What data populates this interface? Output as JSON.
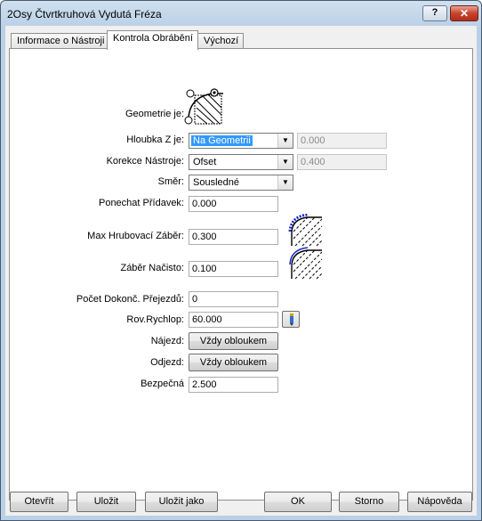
{
  "window": {
    "title": "2Osy Čtvrtkruhová Vydutá Fréza"
  },
  "titlebar": {
    "help_label": "?",
    "close_label": "✕"
  },
  "tabs": [
    {
      "label": "Informace o Nástroji"
    },
    {
      "label": "Kontrola Obrábění"
    },
    {
      "label": "Výchozí"
    }
  ],
  "form": {
    "geometry_label": "Geometrie je:",
    "depth": {
      "label": "Hloubka Z je:",
      "value": "Na Geometrii",
      "disabled_value": "0.000"
    },
    "compensation": {
      "label": "Korekce Nástroje:",
      "value": "Ofset",
      "disabled_value": "0.400"
    },
    "direction": {
      "label": "Směr:",
      "value": "Sousledné"
    },
    "stock": {
      "label": "Ponechat Přídavek:",
      "value": "0.000"
    },
    "max_rough": {
      "label": "Max Hrubovací Záběr:",
      "value": "0.300"
    },
    "finish_cut": {
      "label": "Záběr Načisto:",
      "value": "0.100"
    },
    "finish_passes": {
      "label": "Počet Dokonč. Přejezdů:",
      "value": "0"
    },
    "feed": {
      "label": "Rov.Rychlop:",
      "value": "60.000"
    },
    "approach": {
      "label": "Nájezd:",
      "button": "Vždy obloukem"
    },
    "departure": {
      "label": "Odjezd:",
      "button": "Vždy obloukem"
    },
    "safe": {
      "label": "Bezpečná",
      "value": "2.500"
    }
  },
  "footer": {
    "open": "Otevřít",
    "save": "Uložit",
    "save_as": "Uložit jako",
    "ok": "OK",
    "cancel": "Storno",
    "help": "Nápověda"
  },
  "colors": {
    "selection": "#3399ff",
    "close_button": "#c8432d",
    "profile_accent": "#1a2bd0"
  }
}
